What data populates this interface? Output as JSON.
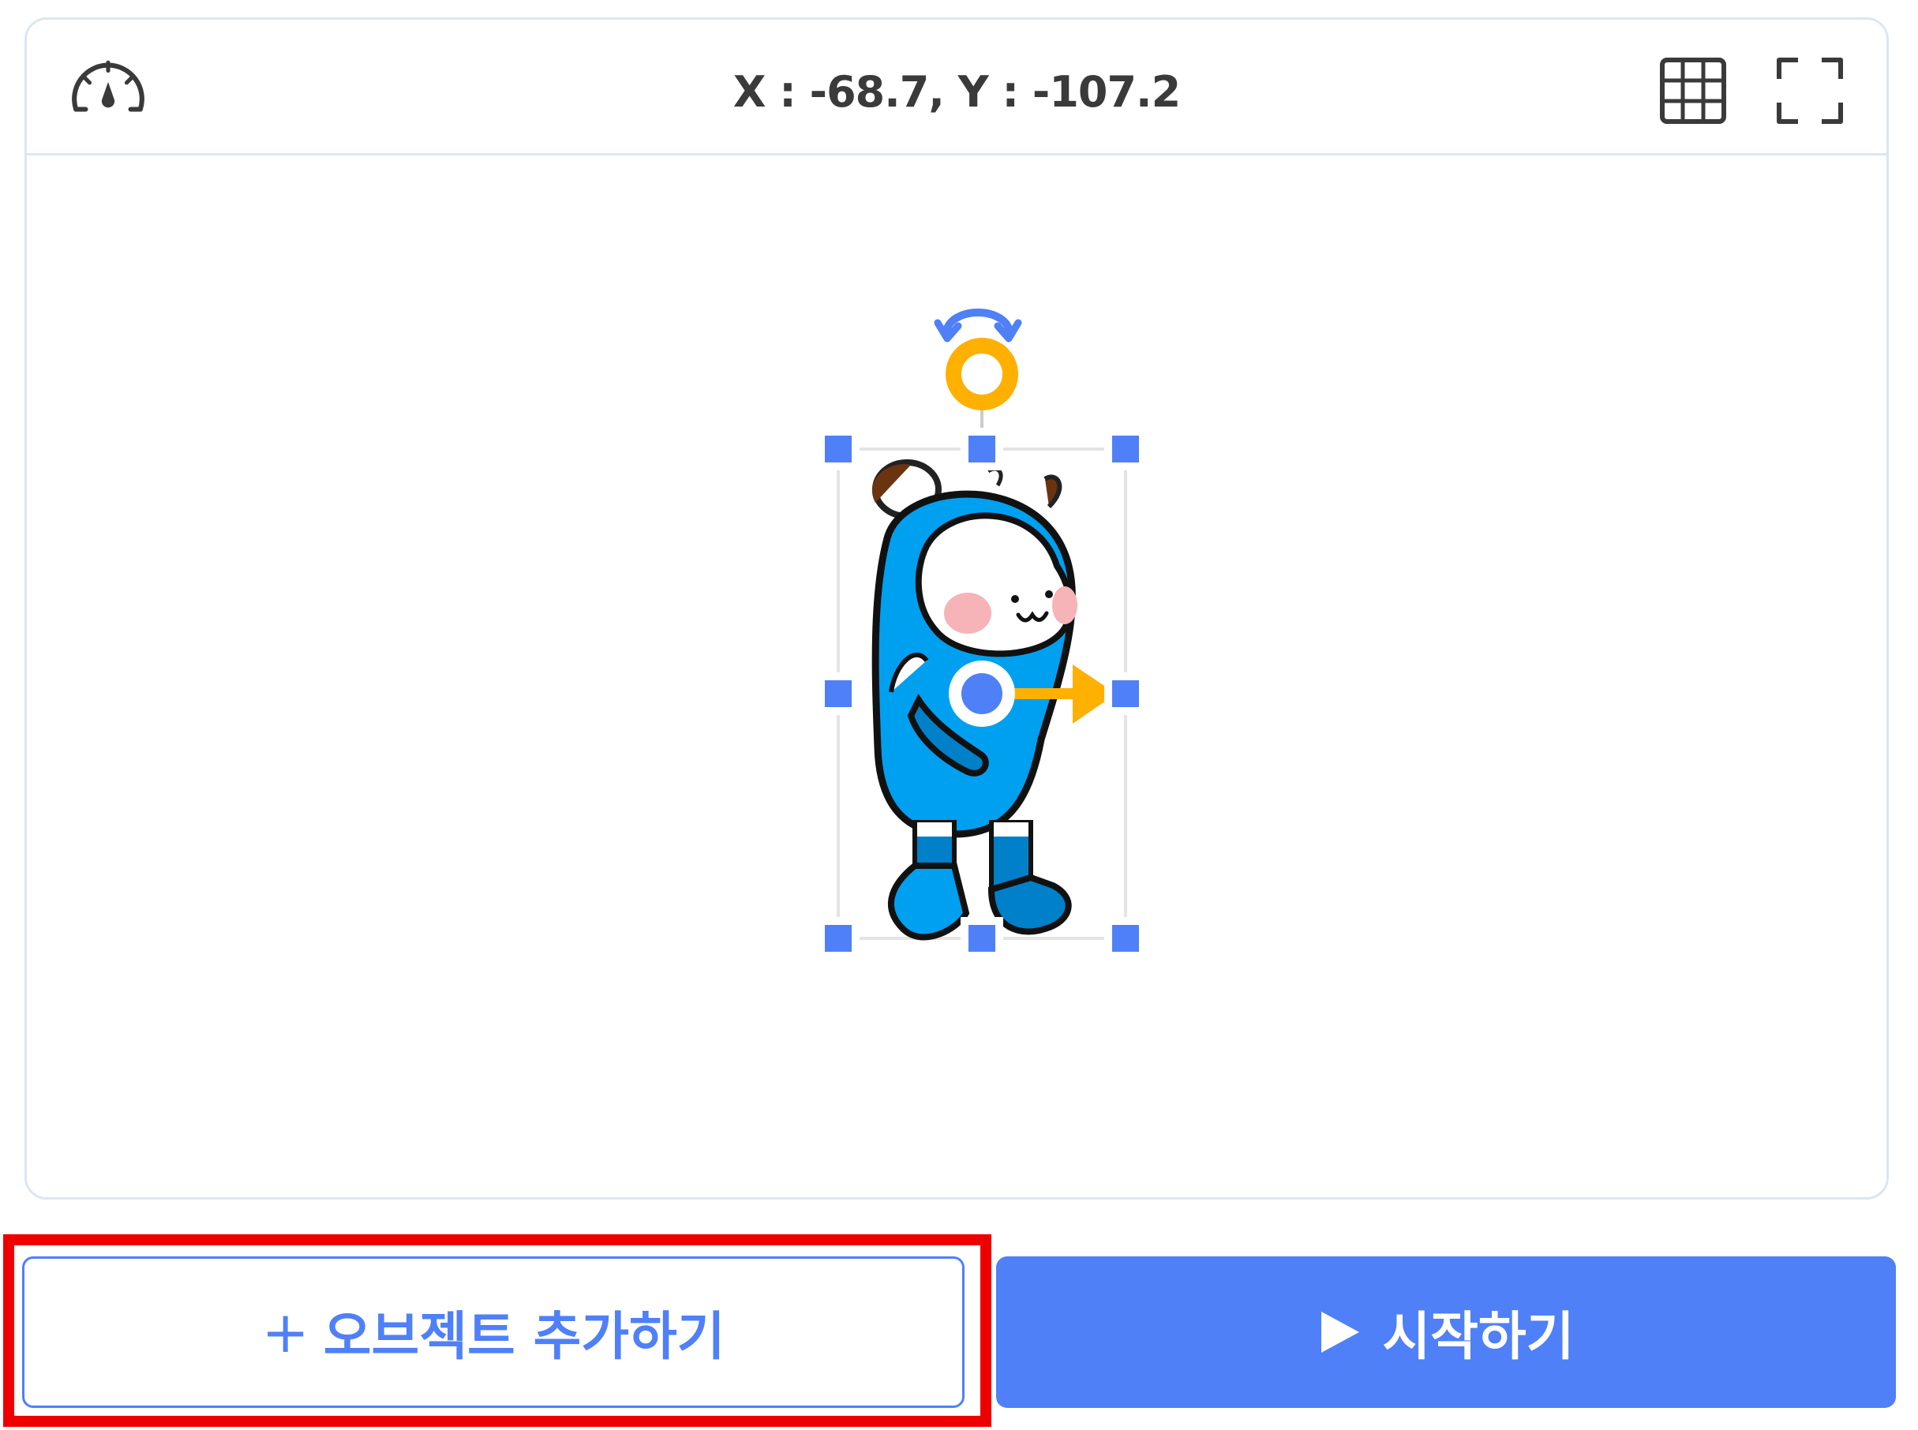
{
  "stage": {
    "coordinates": "X : -68.7, Y : -107.2",
    "icons": {
      "speed": "speedometer-icon",
      "grid": "grid-icon",
      "fullscreen": "fullscreen-icon"
    },
    "sprite": {
      "name": "character-sprite",
      "selected": true
    }
  },
  "buttons": {
    "add_object_plus": "+",
    "add_object_label": "오브젝트 추가하기",
    "start_label": "시작하기"
  },
  "colors": {
    "accent": "#4f80f8",
    "handle": "#4f80f8",
    "rotation_handle": "#ffb000",
    "character_body": "#00a0f0",
    "highlight": "#ee0000",
    "panel_border": "#dde6f2"
  }
}
